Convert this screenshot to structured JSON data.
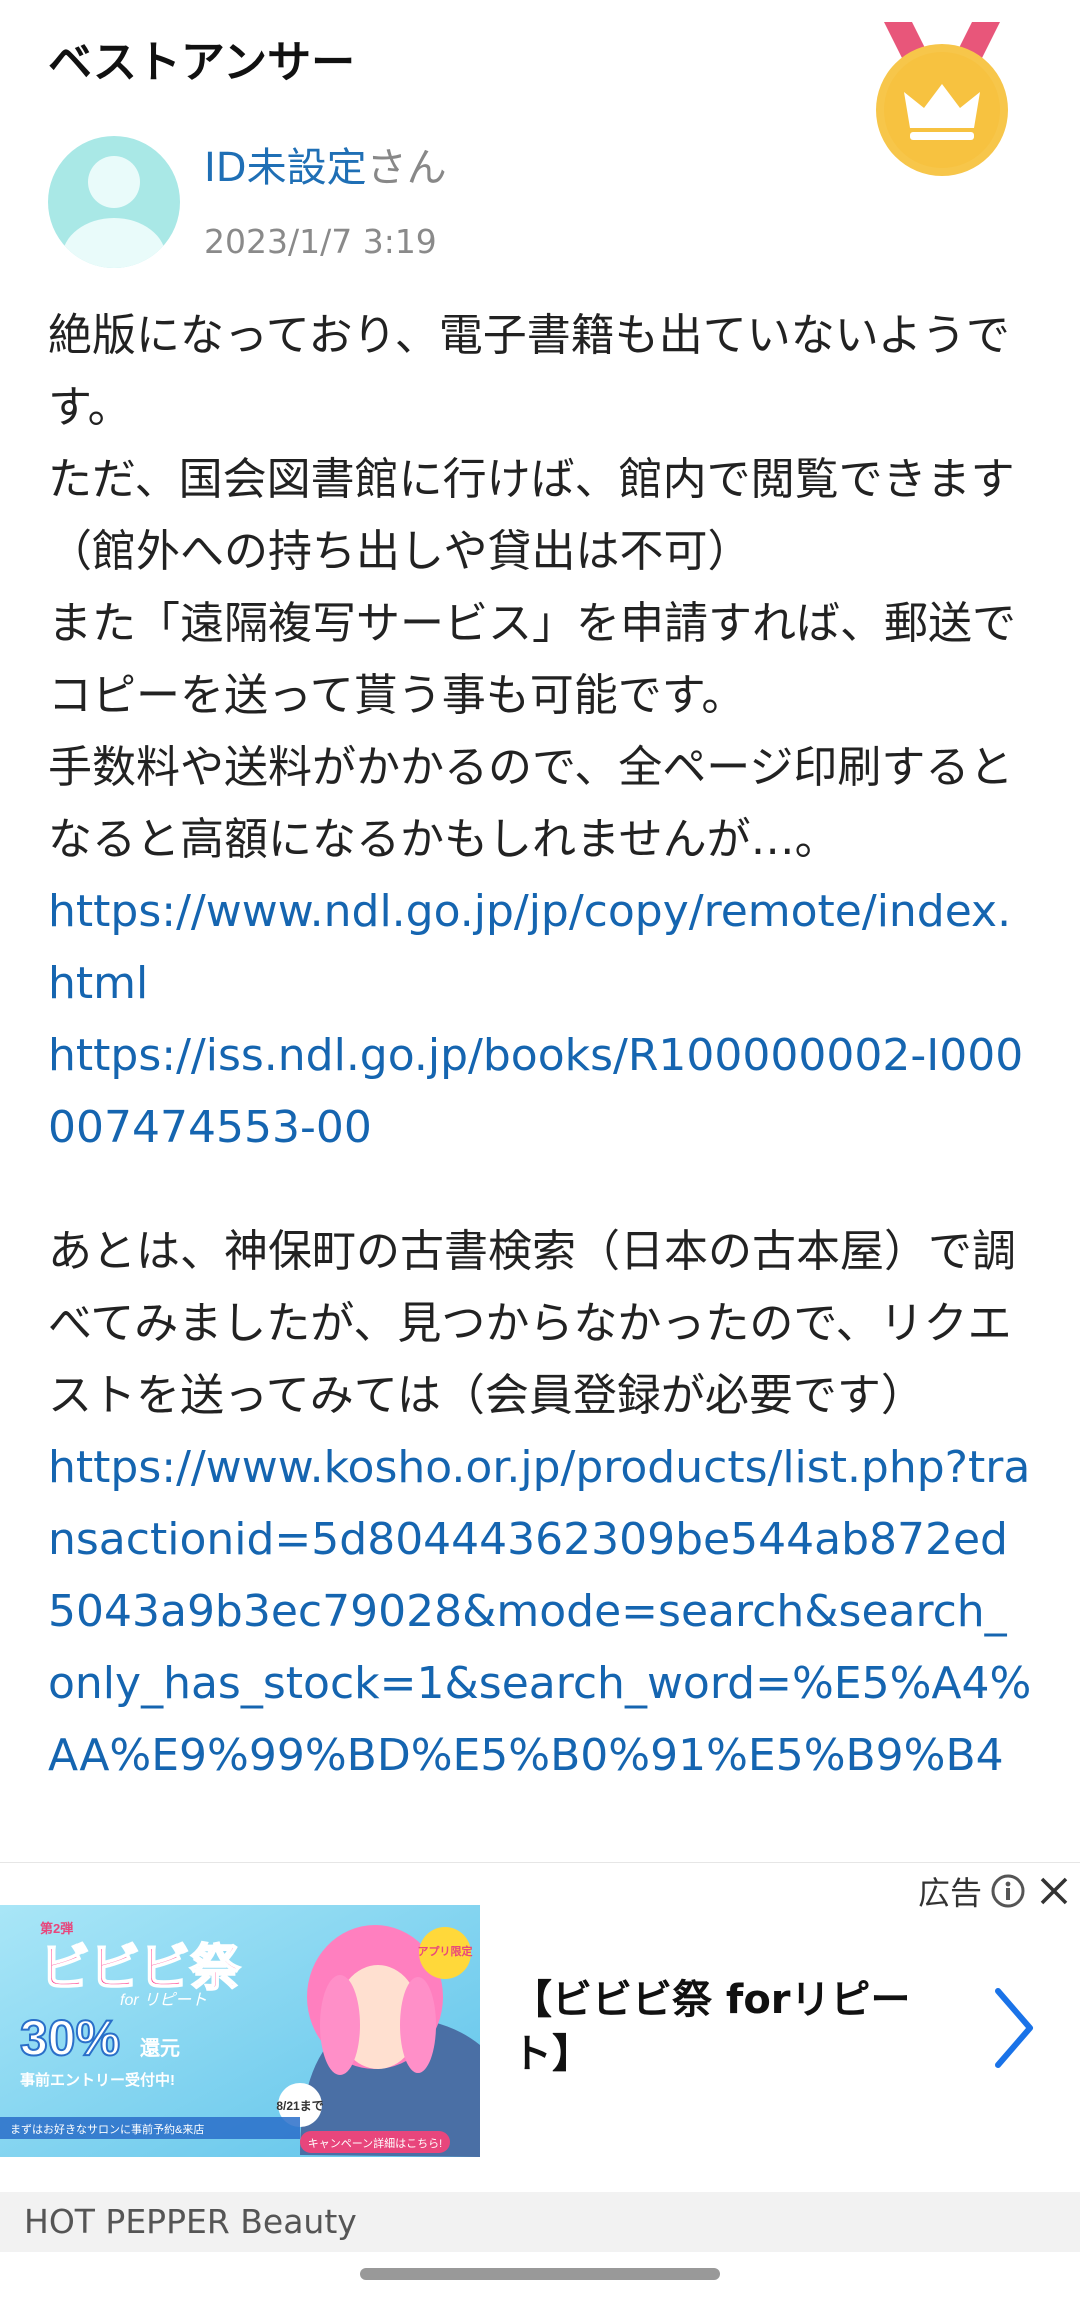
{
  "section": {
    "title": "ベストアンサー"
  },
  "user": {
    "name": "ID未設定",
    "suffix": "さん",
    "date": "2023/1/7 3:19"
  },
  "answer": {
    "p1": "絶版になっており、電子書籍も出ていないようです。",
    "p2": "ただ、国会図書館に行けば、館内で閲覧できます（館外への持ち出しや貸出は不可）",
    "p3": "また「遠隔複写サービス」を申請すれば、郵送でコピーを送って貰う事も可能です。",
    "p4": "手数料や送料がかかるので、全ページ印刷するとなると高額になるかもしれませんが…。",
    "link1": "https://www.ndl.go.jp/jp/copy/remote/index.html",
    "link2": "https://iss.ndl.go.jp/books/R100000002-I000007474553-00",
    "p5": "あとは、神保町の古書検索（日本の古本屋）で調べてみましたが、見つからなかったので、リクエストを送ってみては（会員登録が必要です）",
    "link3": "https://www.kosho.or.jp/products/list.php?transactionid=5d80444362309be544ab872ed5043a9b3ec79028&mode=search&search_only_has_stock=1&search_word=%E5%A4%AA%E9%99%BD%E5%B0%91%E5%B9%B4"
  },
  "ad": {
    "label": "広告",
    "title": "【ビビビ祭 forリピート】",
    "source": "HOT PEPPER Beauty",
    "banner": {
      "badge_small": "第2弾",
      "headline": "ビビビ祭",
      "subline": "for リピート",
      "percent": "30%",
      "percent_unit": "還元",
      "entry": "事前エントリー受付中!",
      "app_only": "アプリ限定",
      "date": "8/21まで",
      "footer": "まずはお好きなサロンに事前予約&来店",
      "cta": "キャンペーン詳細はこちら!"
    }
  },
  "colors": {
    "link": "#1565b0",
    "user_id": "#1f6fb5",
    "medal": "#f7c64a",
    "avatar": "#a9e8e6",
    "arrow": "#1a73e8"
  },
  "icons": {
    "medal": "crown-medal-icon",
    "info": "info-icon",
    "close": "close-icon",
    "arrow": "chevron-right-icon"
  }
}
